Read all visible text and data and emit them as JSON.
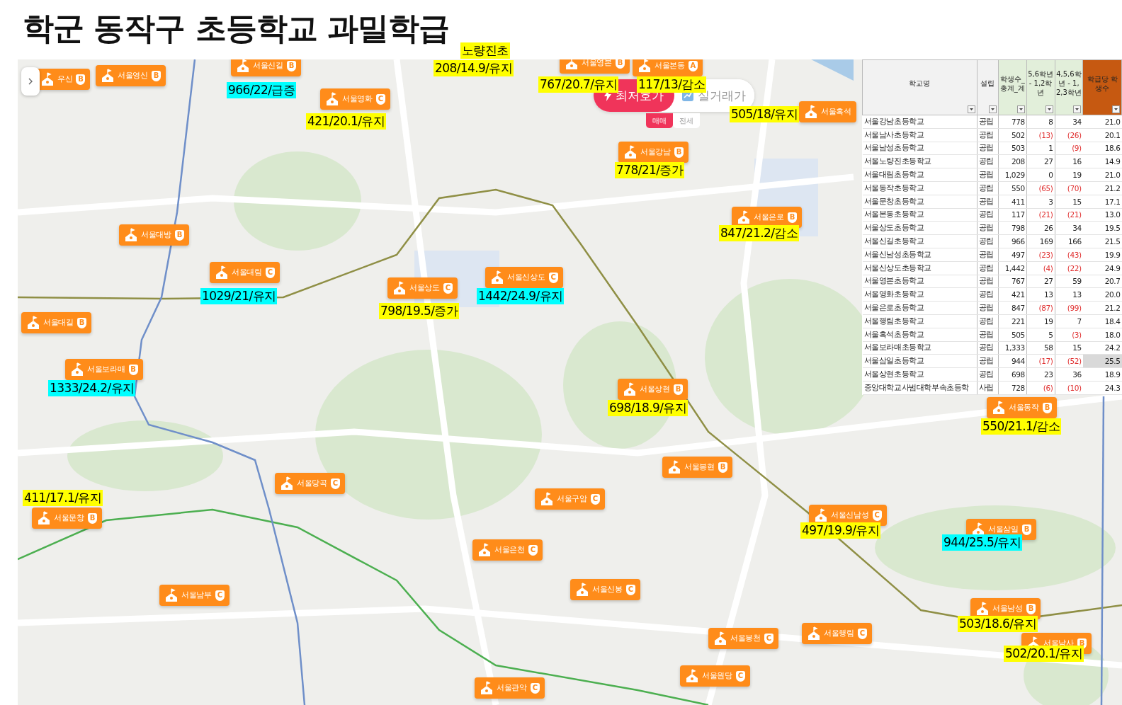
{
  "title": "학군 동작구 초등학교 과밀학급",
  "map": {
    "price_toggle": [
      {
        "label": "최저호가",
        "selected": true
      },
      {
        "label": "실거래가",
        "selected": false
      }
    ],
    "deal_types": [
      {
        "label": "매매",
        "selected": true
      },
      {
        "label": "전세",
        "selected": false
      }
    ],
    "schools": [
      {
        "name": "우신",
        "grade": "B"
      },
      {
        "name": "서울영신",
        "grade": "B"
      },
      {
        "name": "서울신길",
        "grade": "B"
      },
      {
        "name": "서울영화",
        "grade": "C"
      },
      {
        "name": "서울영본",
        "grade": "B"
      },
      {
        "name": "서울본동",
        "grade": "A"
      },
      {
        "name": "서울흑석"
      },
      {
        "name": "서울강남",
        "grade": "B"
      },
      {
        "name": "서울은로",
        "grade": "B"
      },
      {
        "name": "서울대방",
        "grade": "B"
      },
      {
        "name": "서울대림",
        "grade": "C"
      },
      {
        "name": "서울상도",
        "grade": "C"
      },
      {
        "name": "서울신상도",
        "grade": "C"
      },
      {
        "name": "서울대길",
        "grade": "B"
      },
      {
        "name": "서울보라매",
        "grade": "B"
      },
      {
        "name": "서울상현",
        "grade": "B"
      },
      {
        "name": "서울동작",
        "grade": "B"
      },
      {
        "name": "서울봉현",
        "grade": "B"
      },
      {
        "name": "서울당곡",
        "grade": "C"
      },
      {
        "name": "서울구암",
        "grade": "C"
      },
      {
        "name": "서울문창",
        "grade": "B"
      },
      {
        "name": "서울신남성",
        "grade": "C"
      },
      {
        "name": "서울삼일",
        "grade": "B"
      },
      {
        "name": "서울은천",
        "grade": "C"
      },
      {
        "name": "서울남부",
        "grade": "C"
      },
      {
        "name": "서울신봉",
        "grade": "C"
      },
      {
        "name": "서울남성",
        "grade": "B"
      },
      {
        "name": "서울봉천",
        "grade": "C"
      },
      {
        "name": "서울행림",
        "grade": "C"
      },
      {
        "name": "서울남사",
        "grade": "B"
      },
      {
        "name": "서울원당",
        "grade": "C"
      },
      {
        "name": "서울관악",
        "grade": "C"
      }
    ]
  },
  "annotations": [
    {
      "text": "노량진초",
      "color": "#ffff00"
    },
    {
      "text": "208/14.9/유지",
      "color": "#ffff00"
    },
    {
      "text": "966/22/급증",
      "color": "#00ffff"
    },
    {
      "text": "767/20.7/유지",
      "color": "#ffff00"
    },
    {
      "text": "117/13/감소",
      "color": "#ffff00"
    },
    {
      "text": "421/20.1/유지",
      "color": "#ffff00"
    },
    {
      "text": "505/18/유지",
      "color": "#ffff00"
    },
    {
      "text": "778/21/증가",
      "color": "#ffff00"
    },
    {
      "text": "847/21.2/감소",
      "color": "#ffff00"
    },
    {
      "text": "1029/21/유지",
      "color": "#00ffff"
    },
    {
      "text": "798/19.5/증가",
      "color": "#ffff00"
    },
    {
      "text": "1442/24.9/유지",
      "color": "#00ffff"
    },
    {
      "text": "1333/24.2/유지",
      "color": "#00ffff"
    },
    {
      "text": "698/18.9/유지",
      "color": "#ffff00"
    },
    {
      "text": "550/21.1/감소",
      "color": "#ffff00"
    },
    {
      "text": "411/17.1/유지",
      "color": "#ffff00"
    },
    {
      "text": "497/19.9/유지",
      "color": "#ffff00"
    },
    {
      "text": "944/25.5/유지",
      "color": "#00ffff"
    },
    {
      "text": "503/18.6/유지",
      "color": "#ffff00"
    },
    {
      "text": "502/20.1/유지",
      "color": "#ffff00"
    }
  ],
  "table": {
    "columns": [
      {
        "label": "학교명",
        "color": "#f2f2f2"
      },
      {
        "label": "설립",
        "color": "#f2f2f2"
      },
      {
        "label": "학생수_총계_계",
        "color": "#e2efda"
      },
      {
        "label": "5,6학년 - 1,2학년",
        "color": "#e2efda"
      },
      {
        "label": "4,5,6학년 - 1,2,3학년",
        "color": "#e2efda"
      },
      {
        "label": "학급당 학생수",
        "color": "#c65911"
      }
    ],
    "rows": [
      {
        "name": "서울강남초등학교",
        "type": "공립",
        "total": "778",
        "diff_56": {
          "text": "8",
          "negative": false
        },
        "diff_456": {
          "text": "34",
          "negative": false
        },
        "per_class": "21.0",
        "selected": false
      },
      {
        "name": "서울남사초등학교",
        "type": "공립",
        "total": "502",
        "diff_56": {
          "text": "(13)",
          "negative": true
        },
        "diff_456": {
          "text": "(26)",
          "negative": true
        },
        "per_class": "20.1",
        "selected": false
      },
      {
        "name": "서울남성초등학교",
        "type": "공립",
        "total": "503",
        "diff_56": {
          "text": "1",
          "negative": false
        },
        "diff_456": {
          "text": "(9)",
          "negative": true
        },
        "per_class": "18.6",
        "selected": false
      },
      {
        "name": "서울노량진초등학교",
        "type": "공립",
        "total": "208",
        "diff_56": {
          "text": "27",
          "negative": false
        },
        "diff_456": {
          "text": "16",
          "negative": false
        },
        "per_class": "14.9",
        "selected": false
      },
      {
        "name": "서울대림초등학교",
        "type": "공립",
        "total": "1,029",
        "diff_56": {
          "text": "0",
          "negative": false
        },
        "diff_456": {
          "text": "19",
          "negative": false
        },
        "per_class": "21.0",
        "selected": false
      },
      {
        "name": "서울동작초등학교",
        "type": "공립",
        "total": "550",
        "diff_56": {
          "text": "(65)",
          "negative": true
        },
        "diff_456": {
          "text": "(70)",
          "negative": true
        },
        "per_class": "21.2",
        "selected": false
      },
      {
        "name": "서울문창초등학교",
        "type": "공립",
        "total": "411",
        "diff_56": {
          "text": "3",
          "negative": false
        },
        "diff_456": {
          "text": "15",
          "negative": false
        },
        "per_class": "17.1",
        "selected": false
      },
      {
        "name": "서울본동초등학교",
        "type": "공립",
        "total": "117",
        "diff_56": {
          "text": "(21)",
          "negative": true
        },
        "diff_456": {
          "text": "(21)",
          "negative": true
        },
        "per_class": "13.0",
        "selected": false
      },
      {
        "name": "서울상도초등학교",
        "type": "공립",
        "total": "798",
        "diff_56": {
          "text": "26",
          "negative": false
        },
        "diff_456": {
          "text": "34",
          "negative": false
        },
        "per_class": "19.5",
        "selected": false
      },
      {
        "name": "서울신길초등학교",
        "type": "공립",
        "total": "966",
        "diff_56": {
          "text": "169",
          "negative": false
        },
        "diff_456": {
          "text": "166",
          "negative": false
        },
        "per_class": "21.5",
        "selected": false
      },
      {
        "name": "서울신남성초등학교",
        "type": "공립",
        "total": "497",
        "diff_56": {
          "text": "(23)",
          "negative": true
        },
        "diff_456": {
          "text": "(43)",
          "negative": true
        },
        "per_class": "19.9",
        "selected": false
      },
      {
        "name": "서울신상도초등학교",
        "type": "공립",
        "total": "1,442",
        "diff_56": {
          "text": "(4)",
          "negative": true
        },
        "diff_456": {
          "text": "(22)",
          "negative": true
        },
        "per_class": "24.9",
        "selected": false
      },
      {
        "name": "서울영본초등학교",
        "type": "공립",
        "total": "767",
        "diff_56": {
          "text": "27",
          "negative": false
        },
        "diff_456": {
          "text": "59",
          "negative": false
        },
        "per_class": "20.7",
        "selected": false
      },
      {
        "name": "서울영화초등학교",
        "type": "공립",
        "total": "421",
        "diff_56": {
          "text": "13",
          "negative": false
        },
        "diff_456": {
          "text": "13",
          "negative": false
        },
        "per_class": "20.0",
        "selected": false
      },
      {
        "name": "서울은로초등학교",
        "type": "공립",
        "total": "847",
        "diff_56": {
          "text": "(87)",
          "negative": true
        },
        "diff_456": {
          "text": "(99)",
          "negative": true
        },
        "per_class": "21.2",
        "selected": false
      },
      {
        "name": "서울행림초등학교",
        "type": "공립",
        "total": "221",
        "diff_56": {
          "text": "19",
          "negative": false
        },
        "diff_456": {
          "text": "7",
          "negative": false
        },
        "per_class": "18.4",
        "selected": false
      },
      {
        "name": "서울흑석초등학교",
        "type": "공립",
        "total": "505",
        "diff_56": {
          "text": "5",
          "negative": false
        },
        "diff_456": {
          "text": "(3)",
          "negative": true
        },
        "per_class": "18.0",
        "selected": false
      },
      {
        "name": "서울보라매초등학교",
        "type": "공립",
        "total": "1,333",
        "diff_56": {
          "text": "58",
          "negative": false
        },
        "diff_456": {
          "text": "15",
          "negative": false
        },
        "per_class": "24.2",
        "selected": false
      },
      {
        "name": "서울삼일초등학교",
        "type": "공립",
        "total": "944",
        "diff_56": {
          "text": "(17)",
          "negative": true
        },
        "diff_456": {
          "text": "(52)",
          "negative": true
        },
        "per_class": "25.5",
        "selected": true
      },
      {
        "name": "서울상현초등학교",
        "type": "공립",
        "total": "698",
        "diff_56": {
          "text": "23",
          "negative": false
        },
        "diff_456": {
          "text": "36",
          "negative": false
        },
        "per_class": "18.9",
        "selected": false
      },
      {
        "name": "중앙대학교사범대학부속초등학",
        "type": "사립",
        "total": "728",
        "diff_56": {
          "text": "(6)",
          "negative": true
        },
        "diff_456": {
          "text": "(10)",
          "negative": true
        },
        "per_class": "24.3",
        "selected": false
      }
    ]
  }
}
